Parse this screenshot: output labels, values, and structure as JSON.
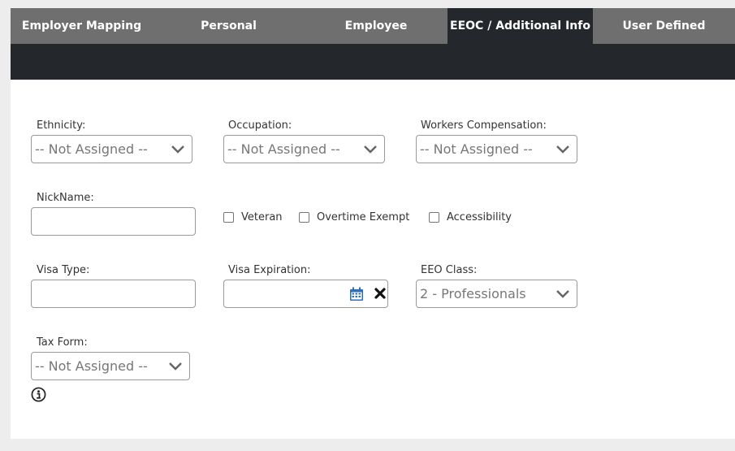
{
  "tabs": [
    {
      "label": "Employer Mapping",
      "active": false
    },
    {
      "label": "Personal",
      "active": false
    },
    {
      "label": "Employee",
      "active": false
    },
    {
      "label": "EEOC / Additional Info",
      "active": true
    },
    {
      "label": "User Defined",
      "active": false
    }
  ],
  "form": {
    "ethnicity": {
      "label": "Ethnicity:",
      "value": "-- Not Assigned --"
    },
    "occupation": {
      "label": "Occupation:",
      "value": "-- Not Assigned --"
    },
    "workers_comp": {
      "label": "Workers Compensation:",
      "value": "-- Not Assigned --"
    },
    "nickname": {
      "label": "NickName:",
      "value": ""
    },
    "checkboxes": {
      "veteran": {
        "label": "Veteran",
        "checked": false
      },
      "overtime_exempt": {
        "label": "Overtime Exempt",
        "checked": false
      },
      "accessibility": {
        "label": "Accessibility",
        "checked": false
      }
    },
    "visa_type": {
      "label": "Visa Type:",
      "value": ""
    },
    "visa_expiration": {
      "label": "Visa Expiration:",
      "value": ""
    },
    "eeo_class": {
      "label": "EEO Class:",
      "value": "2 - Professionals"
    },
    "tax_form": {
      "label": "Tax Form:",
      "value": "-- Not Assigned --"
    }
  },
  "icons": {
    "dropdown": "chevron-down-icon",
    "calendar": "calendar-icon",
    "clear": "close-icon",
    "info": "info-icon"
  },
  "colors": {
    "tab_bg": "#6f6f6f",
    "active_tab_bg": "#24272b",
    "calendar_blue": "#2d6fb8"
  }
}
